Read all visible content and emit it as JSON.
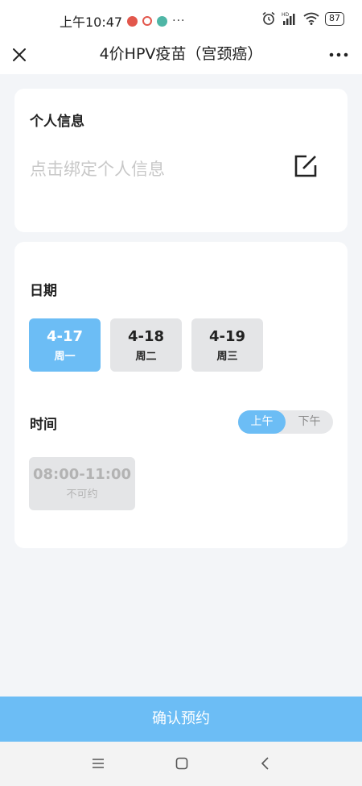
{
  "status_bar": {
    "time": "上午10:47",
    "more": "···",
    "battery": "87",
    "icons": [
      "notification-icon",
      "weibo-icon",
      "app-icon",
      "alarm-icon",
      "hd-signal-icon",
      "wifi-icon",
      "battery-icon"
    ]
  },
  "nav": {
    "title": "4价HPV疫苗（宫颈癌）",
    "close_icon": "close-icon",
    "more_icon": "more-icon"
  },
  "personal": {
    "title": "个人信息",
    "placeholder": "点击绑定个人信息",
    "edit_icon": "edit-icon"
  },
  "schedule": {
    "date_title": "日期",
    "dates": [
      {
        "date": "4-17",
        "weekday": "周一",
        "selected": true
      },
      {
        "date": "4-18",
        "weekday": "周二",
        "selected": false
      },
      {
        "date": "4-19",
        "weekday": "周三",
        "selected": false
      }
    ],
    "time_title": "时间",
    "half_day": {
      "options": [
        "上午",
        "下午"
      ],
      "selected": "上午"
    },
    "slots": [
      {
        "time": "08:00-11:00",
        "status": "不可约"
      }
    ]
  },
  "confirm_label": "确认预约",
  "system_nav": {
    "icons": [
      "menu-icon",
      "home-icon",
      "back-icon"
    ]
  },
  "colors": {
    "accent": "#6cbdf5",
    "background": "#f3f5f8",
    "disabled": "#e4e5e7"
  }
}
